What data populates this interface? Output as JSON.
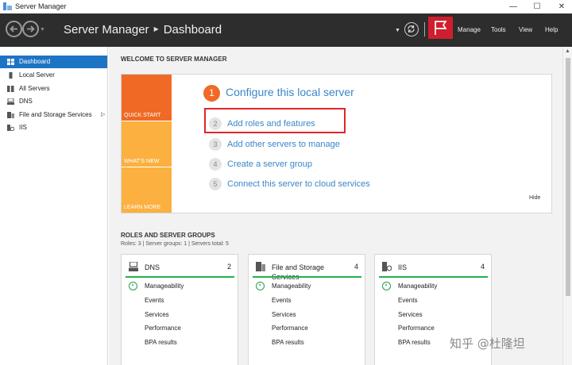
{
  "window": {
    "title": "Server Manager",
    "controls": {
      "minimize": "—",
      "maximize": "☐",
      "close": "✕"
    }
  },
  "header": {
    "breadcrumb": [
      "Server Manager",
      "Dashboard"
    ],
    "menus": [
      "Manage",
      "Tools",
      "View",
      "Help"
    ]
  },
  "sidebar": {
    "items": [
      {
        "label": "Dashboard",
        "icon": "dashboard-icon",
        "active": true
      },
      {
        "label": "Local Server",
        "icon": "server-icon"
      },
      {
        "label": "All Servers",
        "icon": "servers-icon"
      },
      {
        "label": "DNS",
        "icon": "dns-icon"
      },
      {
        "label": "File and Storage Services",
        "icon": "file-storage-icon"
      },
      {
        "label": "IIS",
        "icon": "iis-icon"
      }
    ]
  },
  "welcome": {
    "title": "WELCOME TO SERVER MANAGER",
    "quick_start": "QUICK START",
    "whats_new": "WHAT'S NEW",
    "learn_more": "LEARN MORE",
    "steps": [
      {
        "num": "1",
        "label": "Configure this local server"
      },
      {
        "num": "2",
        "label": "Add roles and features"
      },
      {
        "num": "3",
        "label": "Add other servers to manage"
      },
      {
        "num": "4",
        "label": "Create a server group"
      },
      {
        "num": "5",
        "label": "Connect this server to cloud services"
      }
    ],
    "hide": "Hide"
  },
  "roles": {
    "title": "ROLES AND SERVER GROUPS",
    "summary": "Roles: 3   |   Server groups: 1   |   Servers total: 5",
    "cards": [
      {
        "title": "DNS",
        "count": "2",
        "icon": "dns-icon",
        "rows": [
          "Manageability",
          "Events",
          "Services",
          "Performance",
          "BPA results"
        ]
      },
      {
        "title": "File and Storage Services",
        "count": "4",
        "icon": "file-storage-icon",
        "rows": [
          "Manageability",
          "Events",
          "Services",
          "Performance",
          "BPA results"
        ]
      },
      {
        "title": "IIS",
        "count": "4",
        "icon": "iis-icon",
        "rows": [
          "Manageability",
          "Events",
          "Services",
          "Performance",
          "BPA results"
        ]
      }
    ]
  },
  "watermark": "知乎 @杜隆坦",
  "colors": {
    "header_bg": "#2d2d2d",
    "accent_blue": "#1d74c4",
    "quick_start_orange": "#f06a25",
    "tile_yellow": "#fbb040",
    "status_green": "#22b14c",
    "highlight_red": "#e0262a",
    "flag_red": "#d01e2e"
  }
}
